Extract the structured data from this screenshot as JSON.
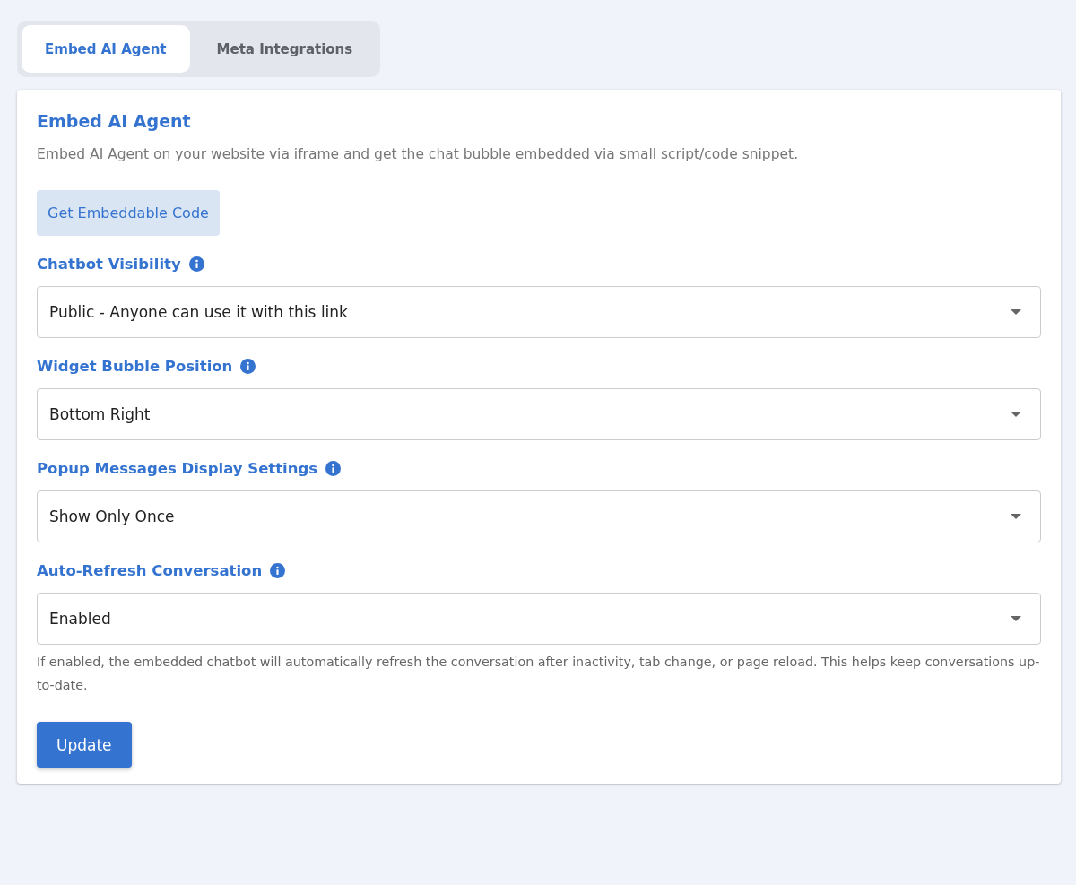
{
  "tabs": [
    {
      "label": "Embed AI Agent",
      "selected": true
    },
    {
      "label": "Meta Integrations",
      "selected": false
    }
  ],
  "card": {
    "title": "Embed AI Agent",
    "description": "Embed AI Agent on your website via iframe and get the chat bubble embedded via small script/code snippet.",
    "code_button": "Get Embeddable Code"
  },
  "fields": [
    {
      "label": "Chatbot Visibility",
      "value": "Public - Anyone can use it with this link"
    },
    {
      "label": "Widget Bubble Position",
      "value": "Bottom Right"
    },
    {
      "label": "Popup Messages Display Settings",
      "value": "Show Only Once"
    },
    {
      "label": "Auto-Refresh Conversation",
      "value": "Enabled",
      "help": "If enabled, the embedded chatbot will automatically refresh the conversation after inactivity, tab change, or page reload. This helps keep conversations up-to-date."
    }
  ],
  "update_button": "Update"
}
